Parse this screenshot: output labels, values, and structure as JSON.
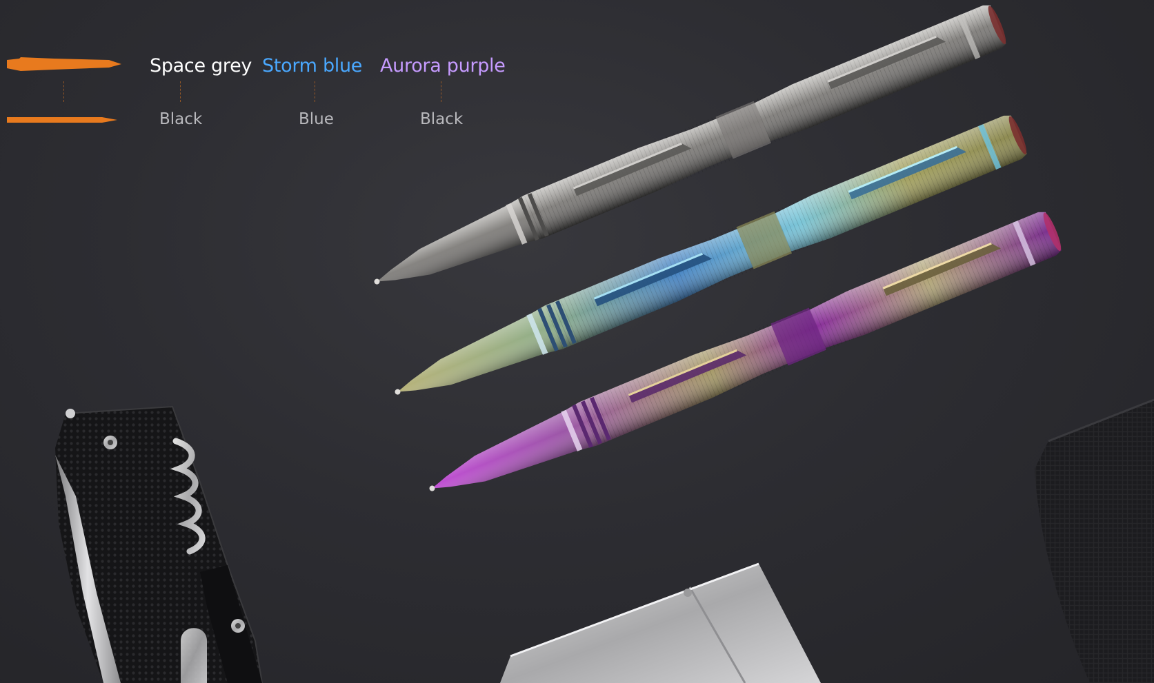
{
  "legend": {
    "variants": [
      {
        "color_name": "Space grey",
        "ink": "Black",
        "label_color": "#ffffff"
      },
      {
        "color_name": "Storm blue",
        "ink": "Blue",
        "label_color": "#4aa8ff"
      },
      {
        "color_name": "Aurora purple",
        "ink": "Black",
        "label_color": "#c69bff"
      }
    ],
    "silhouette_color": "#e87a1e"
  },
  "pens": [
    {
      "name": "Space grey",
      "color": "#8e8c8a"
    },
    {
      "name": "Storm blue",
      "color": "#5fb4d6"
    },
    {
      "name": "Aurora purple",
      "color": "#9a3fb0"
    }
  ]
}
